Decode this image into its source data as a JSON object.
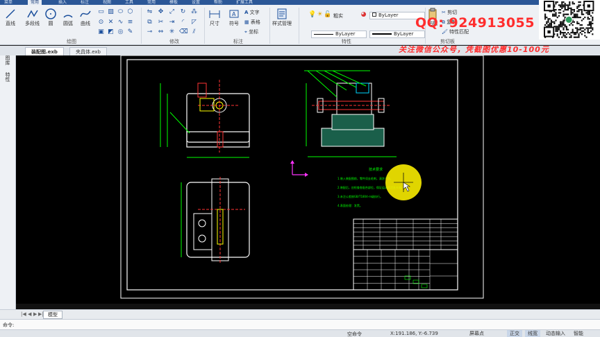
{
  "menu": {
    "tabs": [
      "菜单",
      "常用",
      "插入",
      "标注",
      "视图",
      "工具",
      "常用",
      "模板",
      "设置",
      "帮助",
      "扩展工具"
    ],
    "active_index": 1
  },
  "ribbon": {
    "draw": {
      "label": "绘图",
      "line": "直线",
      "polyline": "多段线",
      "circle": "圆",
      "arc": "圆弧",
      "curve": "曲线"
    },
    "modify": {
      "label": "修改"
    },
    "annotation": {
      "label": "标注",
      "dimension": "尺寸",
      "symbol": "符号",
      "text": "文字",
      "table": "表格",
      "coordinate": "坐标"
    },
    "style": {
      "style_manager": "样式管理"
    },
    "properties": {
      "label": "特性",
      "layer_name": "粗实",
      "color_value": "ByLayer",
      "linetype_value": "ByLayer",
      "lineweight_value": "ByLayer"
    },
    "clipboard": {
      "label": "剪切板",
      "cut": "剪切",
      "copy": "复制",
      "paste": "粘贴",
      "match": "特性匹配"
    }
  },
  "overlay": {
    "qq": "QQ: 924913055",
    "banner": "关注微信公众号，凭截图优惠10-100元"
  },
  "documents": {
    "tabs": [
      "装配图.exb",
      "夹具体.exb"
    ],
    "active_index": 0
  },
  "left_panel": {
    "tabs": [
      "图库",
      "特性"
    ]
  },
  "drawing": {
    "tech_title": "技术要求",
    "tech_lines": [
      "1.装入装配图前，零件须去毛刺，清洗干净。",
      "2.装配后，应检查各配合部位，保证运动灵活无卡滞。",
      "3.未注公差按GB/T1804-m级执行。",
      "4.表面处理：发黑。"
    ]
  },
  "layout": {
    "model_tab": "模型"
  },
  "command": {
    "prompt": "命令:"
  },
  "status": {
    "command_state": "空命令",
    "coordinates": "X:191.186, Y:-6.739",
    "snap_mode": "屏幕点",
    "ortho": "正交",
    "linewidth": "线宽",
    "dynamic_input": "动态输入",
    "smart": "智能"
  },
  "colors": {
    "menubar": "#2b5797",
    "ribbon_bg": "#eef1f5",
    "canvas_bg": "#000000",
    "drawing_white": "#ffffff",
    "drawing_green": "#00ff00",
    "drawing_yellow": "#ffff00",
    "drawing_red": "#ff3333",
    "drawing_cyan": "#00d9ff",
    "drawing_magenta": "#ff33ff",
    "overlay_red": "#ff2d2d",
    "cursor_highlight": "#fff200"
  }
}
